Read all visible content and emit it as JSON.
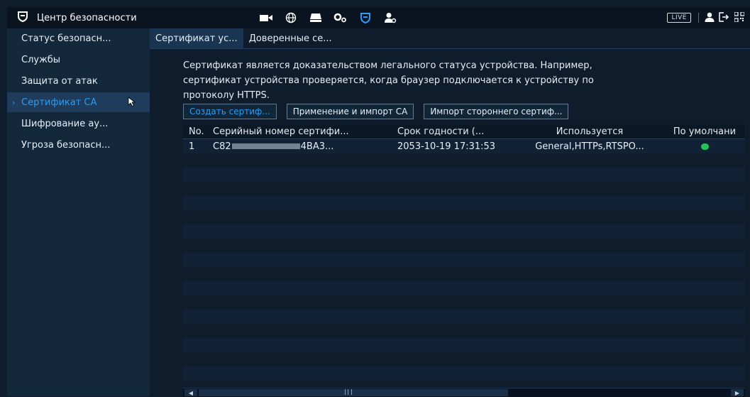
{
  "header": {
    "title": "Центр безопасности",
    "live_label": "LIVE",
    "icons": [
      "shield-icon",
      "camera-icon",
      "globe-icon",
      "storage-icon",
      "settings-icon",
      "shield-icon",
      "account-settings-icon",
      "user-icon",
      "logout-icon",
      "qr-icon"
    ]
  },
  "sidebar": {
    "items": [
      {
        "label": "Статус безопасн..."
      },
      {
        "label": "Службы"
      },
      {
        "label": "Защита от атак"
      },
      {
        "label": "Сертификат CA"
      },
      {
        "label": "Шифрование ау..."
      },
      {
        "label": "Угроза безопасн..."
      }
    ],
    "active_index": 3
  },
  "tabs": [
    {
      "label": "Сертификат ус..."
    },
    {
      "label": "Доверенные се..."
    }
  ],
  "description": {
    "line1": "Сертификат является доказательством легального статуса устройства. Например,",
    "line2": "сертификат устройства проверяется, когда браузер подключается к устройству по",
    "line3": "протоколу HTTPS."
  },
  "buttons": {
    "create": "Создать сертиф...",
    "apply_import": "Применение и импорт CA",
    "import_third": "Импорт стороннего сертиф..."
  },
  "table": {
    "columns": [
      "No.",
      "Серийный номер сертифи...",
      "Срок годности (...",
      "Используется",
      "По умолчани"
    ],
    "rows": [
      {
        "no": "1",
        "serial_prefix": "C82",
        "serial_suffix": "4BA3...",
        "expiry": "2053-10-19 17:31:53",
        "used": "General,HTTPs,RTSPO...",
        "default": true
      }
    ]
  },
  "colors": {
    "accent": "#2a9df4",
    "ok": "#27c25a"
  }
}
